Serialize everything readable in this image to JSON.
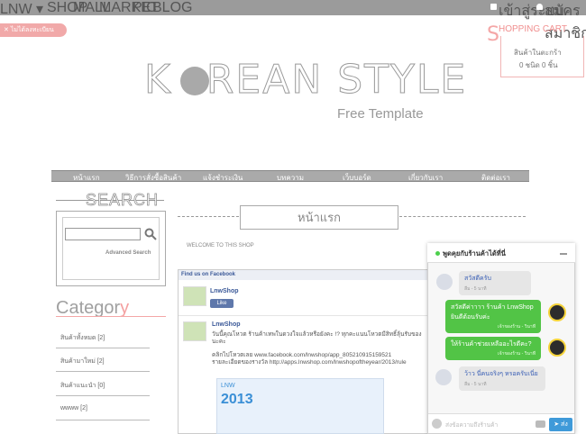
{
  "topbar": {
    "logo": "LNW ▾",
    "nav": [
      "SHOP",
      "MALL",
      "MARKET",
      "PIC",
      "BLOG"
    ],
    "login": "เข้าสู่ระบบ",
    "register": "สมัครสมาชิก"
  },
  "not_registered": "ไม่ได้ลงทะเบียน",
  "cart": {
    "title": "SHOPPING CART",
    "title_rest": "HOPPING CART",
    "title_s": "S",
    "line1": "สินค้าในตะกร้า",
    "line2": "0 ชนิด 0 ชิ้น"
  },
  "brand": {
    "title_left": "K",
    "title_right": "REAN STYLE",
    "subtitle": "Free Template"
  },
  "main_nav": [
    "หน้าแรก",
    "วิธีการสั่งซื้อสินค้า",
    "แจ้งชำระเงิน",
    "บทความ",
    "เว็บบอร์ด",
    "เกี่ยวกับเรา",
    "ติดต่อเรา"
  ],
  "search": {
    "title": "SEARCH",
    "advanced": "Advanced Search"
  },
  "category": {
    "title": "Categor",
    "title_y": "y",
    "items": [
      "สินค้าทั้งหมด [2]",
      "สินค้ามาใหม่ [2]",
      "สินค้าแนะนำ [0]",
      "wwww [2]"
    ]
  },
  "page": {
    "heading": "หน้าแรก",
    "welcome": "WELCOME TO THIS SHOP"
  },
  "facebook": {
    "header": "Find us on Facebook",
    "page_name": "LnwShop",
    "like": "Like",
    "post_name": "LnwShop",
    "post_line1": "วันนี้คุณโหวต ร้านค้าเทพในดวงใจแล้วหรือยังคะ !? ทุกคะแนนโหวตมีสิทธิ์ลุ้นรับของ",
    "post_line2": "นะคะ",
    "post_line3": "คลิกไปโหวตเลย www.facebook.com/lnwshop/app_805210915159521",
    "post_line4": "รายละเอียดของรางวัล http://apps.lnwshop.com/lnwshopoftheyear/2013/rule",
    "image_brand": "LNW",
    "image_year": "2013"
  },
  "chat": {
    "title": "พูดคุยกับร้านค้าได้ที่นี่",
    "messages": [
      {
        "from": "user",
        "text": "สวัสดีครับ",
        "time": "ลืม - 5 นาที"
      },
      {
        "from": "shop",
        "text": "สวัสดีค่าาาา ร้านค้า LnwShop ยินดีต้อนรับค่ะ",
        "time": "เจ้าของร้าน - วินาที"
      },
      {
        "from": "shop",
        "text": "ให้ร้านค้าช่วยเหลืออะไรดีคะ?",
        "time": "เจ้าของร้าน - วินาที"
      },
      {
        "from": "user",
        "text": "ว้าว นี่คนจริงๆ หรอครับเนี่ย",
        "time": "ลืม - 5 นาที"
      }
    ],
    "placeholder": "ส่งข้อความถึงร้านค้า",
    "send": "ส่ง"
  },
  "colors": {
    "topbar": "#9b9b9b",
    "accent_pink": "#f4a7a7",
    "chat_green": "#52c446",
    "send_blue": "#3f9ad9"
  }
}
